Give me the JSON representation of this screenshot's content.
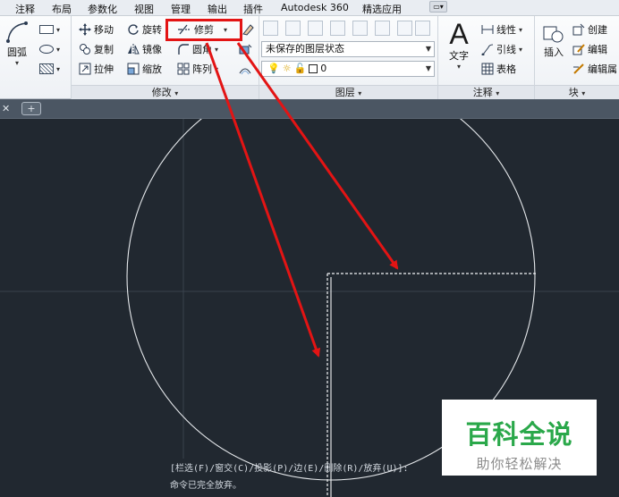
{
  "menu": [
    "注释",
    "布局",
    "参数化",
    "视图",
    "管理",
    "输出",
    "插件",
    "Autodesk 360",
    "精选应用"
  ],
  "ribbon": {
    "draw": {
      "arc_label": "圆弧"
    },
    "modify": {
      "title": "修改",
      "move": "移动",
      "rotate": "旋转",
      "trim": "修剪",
      "copy": "复制",
      "mirror": "镜像",
      "fillet": "圆角",
      "stretch": "拉伸",
      "scale": "缩放",
      "array": "阵列"
    },
    "layers": {
      "title": "图层",
      "state": "未保存的图层状态",
      "layer": "0"
    },
    "annotation": {
      "title": "注释",
      "text": "文字",
      "linear": "线性",
      "leader": "引线",
      "table": "表格"
    },
    "block": {
      "title": "块",
      "insert": "插入",
      "create": "创建",
      "edit": "编辑",
      "edit_attr": "编辑属"
    }
  },
  "command_line": [
    "[栏选(F)/窗交(C)/投影(P)/边(E)/删除(R)/放弃(U)]:",
    "命令已完全放弃。"
  ],
  "watermark": {
    "title": "百科全说",
    "subtitle": "助你轻松解决"
  },
  "colors": {
    "canvas": "#212830",
    "highlight": "#e31414",
    "watermark_green": "#2aa84a"
  }
}
